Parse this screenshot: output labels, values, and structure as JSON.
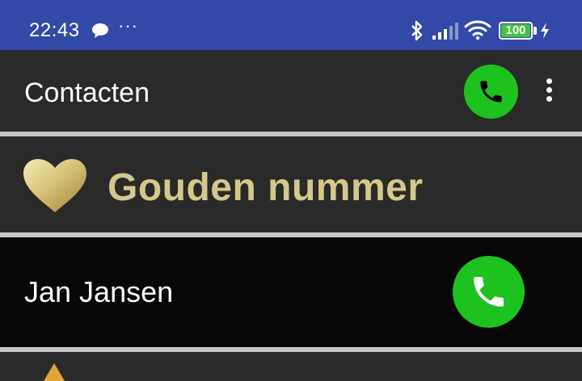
{
  "status_bar": {
    "time": "22:43",
    "battery_level": "100",
    "icons": [
      "chat-bubble-icon",
      "more-dots-icon",
      "bluetooth-icon",
      "signal-icon",
      "wifi-icon",
      "battery-icon",
      "charging-icon"
    ]
  },
  "app_bar": {
    "title": "Contacten",
    "call_icon": "phone-icon",
    "menu_icon": "overflow-menu-icon"
  },
  "golden_number": {
    "label": "Gouden nummer",
    "icon": "heart-icon"
  },
  "contacts": [
    {
      "name": "Jan Jansen",
      "call_icon": "phone-icon"
    }
  ],
  "colors": {
    "status_bar": "#3349a8",
    "app_bar": "#2a2a2a",
    "call_green": "#1ec21e",
    "gold_text": "#d4c88a",
    "separator": "#c8c8c8",
    "battery_green": "#43c243"
  }
}
